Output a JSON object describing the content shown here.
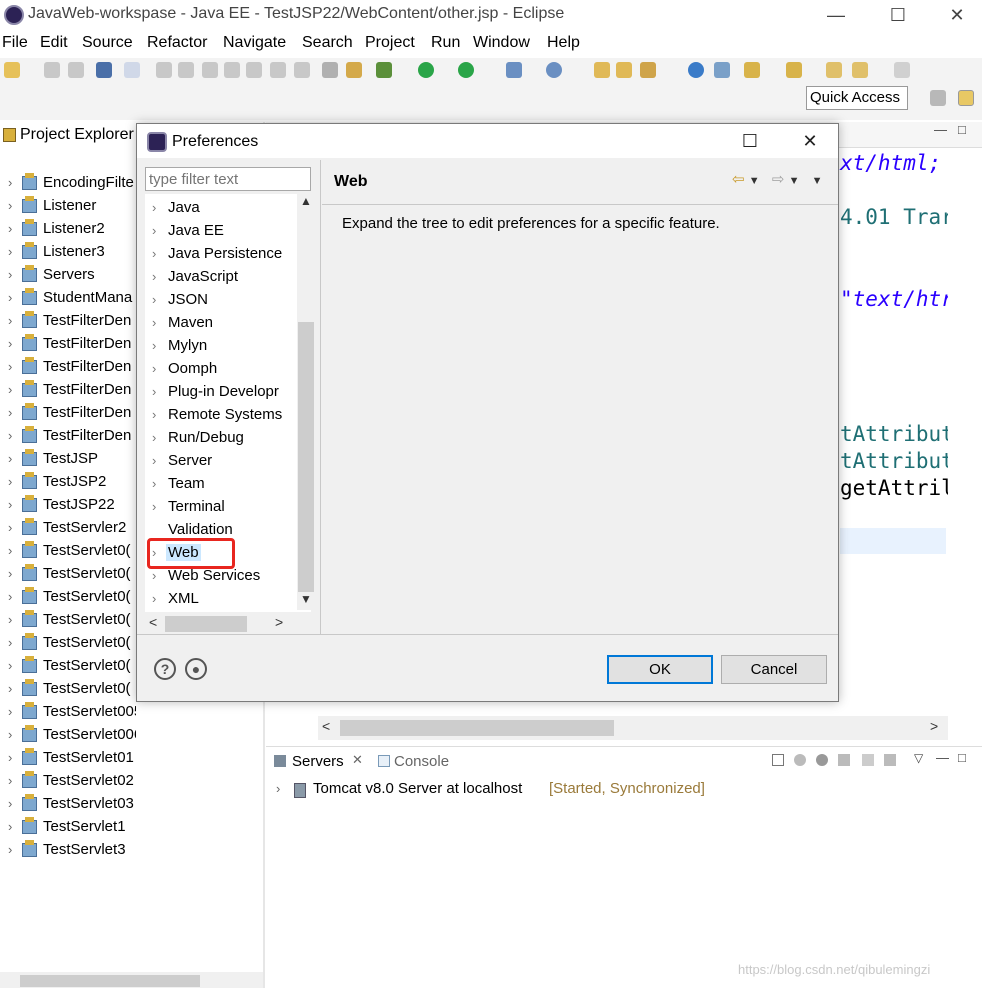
{
  "window": {
    "title": "JavaWeb-workspase - Java EE - TestJSP22/WebContent/other.jsp - Eclipse"
  },
  "menu": [
    "File",
    "Edit",
    "Source",
    "Refactor",
    "Navigate",
    "Search",
    "Project",
    "Run",
    "Window",
    "Help"
  ],
  "toolbar": {
    "quick_access": "Quick Access"
  },
  "project_explorer": {
    "title": "Project Explorer",
    "items": [
      "EncodingFilte",
      "Listener",
      "Listener2",
      "Listener3",
      "Servers",
      "StudentMana",
      "TestFilterDen",
      "TestFilterDen",
      "TestFilterDen",
      "TestFilterDen",
      "TestFilterDen",
      "TestFilterDen",
      "TestJSP",
      "TestJSP2",
      "TestJSP22",
      "TestServler2",
      "TestServlet0(",
      "TestServlet0(",
      "TestServlet0(",
      "TestServlet0(",
      "TestServlet0(",
      "TestServlet0(",
      "TestServlet0(",
      "TestServlet005",
      "TestServlet006",
      "TestServlet01",
      "TestServlet02",
      "TestServlet03",
      "TestServlet1",
      "TestServlet3"
    ]
  },
  "editor": {
    "lines": [
      "xt/html;",
      "4.01 Trar",
      "\"text/htr",
      "tAttribut",
      "tAttribut",
      "getAttril"
    ]
  },
  "servers_panel": {
    "tabs": [
      "Servers",
      "Console"
    ],
    "server_name": "Tomcat v8.0 Server at localhost",
    "server_status": "[Started, Synchronized]"
  },
  "dialog": {
    "title": "Preferences",
    "filter_placeholder": "type filter text",
    "tree": [
      {
        "label": "Java",
        "expandable": true
      },
      {
        "label": "Java EE",
        "expandable": true
      },
      {
        "label": "Java Persistence",
        "expandable": true
      },
      {
        "label": "JavaScript",
        "expandable": true
      },
      {
        "label": "JSON",
        "expandable": true
      },
      {
        "label": "Maven",
        "expandable": true
      },
      {
        "label": "Mylyn",
        "expandable": true
      },
      {
        "label": "Oomph",
        "expandable": true
      },
      {
        "label": "Plug-in Developr",
        "expandable": true
      },
      {
        "label": "Remote Systems",
        "expandable": true
      },
      {
        "label": "Run/Debug",
        "expandable": true
      },
      {
        "label": "Server",
        "expandable": true
      },
      {
        "label": "Team",
        "expandable": true
      },
      {
        "label": "Terminal",
        "expandable": true
      },
      {
        "label": "Validation",
        "expandable": false
      },
      {
        "label": "Web",
        "expandable": true,
        "selected": true
      },
      {
        "label": "Web Services",
        "expandable": true
      },
      {
        "label": "XML",
        "expandable": true
      }
    ],
    "page_heading": "Web",
    "page_description": "Expand the tree to edit preferences for a specific feature.",
    "ok_label": "OK",
    "cancel_label": "Cancel",
    "highlight_color": "#e8261f"
  },
  "watermark": "https://blog.csdn.net/qibulemingzi"
}
